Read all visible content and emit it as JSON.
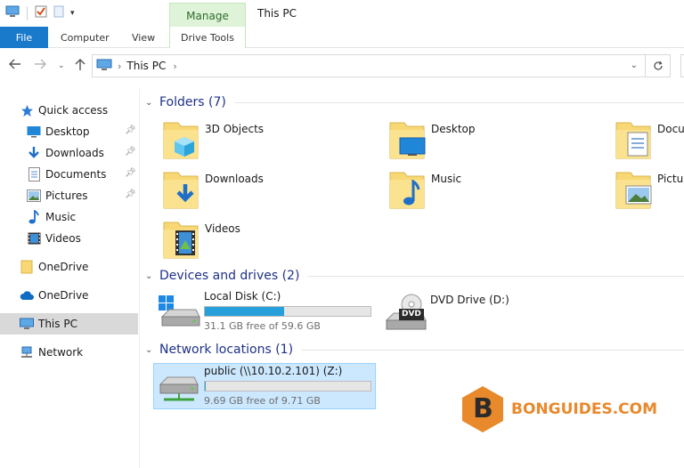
{
  "window": {
    "title": "This PC",
    "manage_tab": "Manage"
  },
  "ribbon": {
    "file": "File",
    "computer": "Computer",
    "view": "View",
    "drive_tools": "Drive Tools"
  },
  "address": {
    "crumb": "This PC",
    "back_icon": "arrow-left-icon",
    "forward_icon": "arrow-right-icon",
    "up_icon": "arrow-up-icon",
    "refresh_icon": "refresh-icon"
  },
  "sidebar": {
    "items": [
      {
        "label": "Quick access",
        "icon": "star-icon",
        "pinned": false
      },
      {
        "label": "Desktop",
        "icon": "desktop-icon",
        "pinned": true
      },
      {
        "label": "Downloads",
        "icon": "download-icon",
        "pinned": true
      },
      {
        "label": "Documents",
        "icon": "document-icon",
        "pinned": true
      },
      {
        "label": "Pictures",
        "icon": "picture-icon",
        "pinned": true
      },
      {
        "label": "Music",
        "icon": "music-icon",
        "pinned": false
      },
      {
        "label": "Videos",
        "icon": "video-icon",
        "pinned": false
      },
      {
        "label": "OneDrive",
        "icon": "folder-icon",
        "pinned": false
      },
      {
        "label": "OneDrive",
        "icon": "cloud-icon",
        "pinned": false
      },
      {
        "label": "This PC",
        "icon": "computer-icon",
        "pinned": false,
        "selected": true
      },
      {
        "label": "Network",
        "icon": "network-icon",
        "pinned": false
      }
    ]
  },
  "groups": {
    "folders": "Folders (7)",
    "devices": "Devices and drives (2)",
    "network": "Network locations (1)"
  },
  "folders": [
    {
      "label": "3D Objects",
      "overlay": "cube-icon"
    },
    {
      "label": "Desktop",
      "overlay": "desktop-icon"
    },
    {
      "label": "Docum",
      "overlay": "document-icon"
    },
    {
      "label": "Downloads",
      "overlay": "download-icon"
    },
    {
      "label": "Music",
      "overlay": "music-icon"
    },
    {
      "label": "Pictur",
      "overlay": "picture-icon"
    },
    {
      "label": "Videos",
      "overlay": "video-icon"
    }
  ],
  "drives": [
    {
      "name": "Local Disk (C:)",
      "free": "31.1 GB free of 59.6 GB",
      "used_fraction": 0.48
    },
    {
      "name": "DVD Drive (D:)",
      "badge": "DVD"
    }
  ],
  "network_locations": [
    {
      "name": "public (\\\\10.10.2.101) (Z:)",
      "free": "9.69 GB free of 9.71 GB",
      "used_fraction": 0.002
    }
  ],
  "watermark": {
    "letter": "B",
    "text": "BONGUIDES.COM"
  },
  "colors": {
    "accent": "#1979ca",
    "folder_yellow": "#f8d775",
    "group_header": "#1e3287",
    "selection": "#cce8ff",
    "progress": "#26a0da",
    "watermark": "#e8892b"
  }
}
